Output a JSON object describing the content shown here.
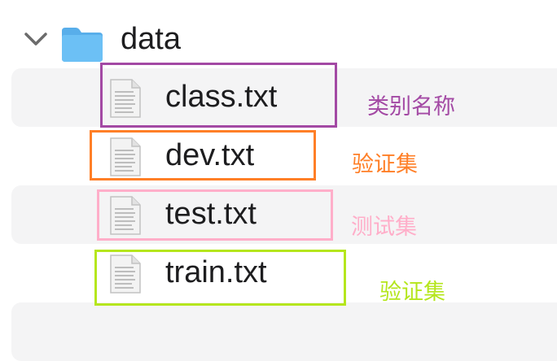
{
  "folder": {
    "name": "data",
    "expanded": true,
    "icon": "folder-icon",
    "color": "#58aeea"
  },
  "files": [
    {
      "name": "class.txt",
      "icon": "text-file-icon"
    },
    {
      "name": "dev.txt",
      "icon": "text-file-icon"
    },
    {
      "name": "test.txt",
      "icon": "text-file-icon"
    },
    {
      "name": "train.txt",
      "icon": "text-file-icon"
    }
  ],
  "annotations": [
    {
      "label": "类别名称",
      "color": "#a349a4"
    },
    {
      "label": "验证集",
      "color": "#ff7f27"
    },
    {
      "label": "测试集",
      "color": "#ffaec9"
    },
    {
      "label": "验证集",
      "color": "#b5e61d"
    }
  ]
}
